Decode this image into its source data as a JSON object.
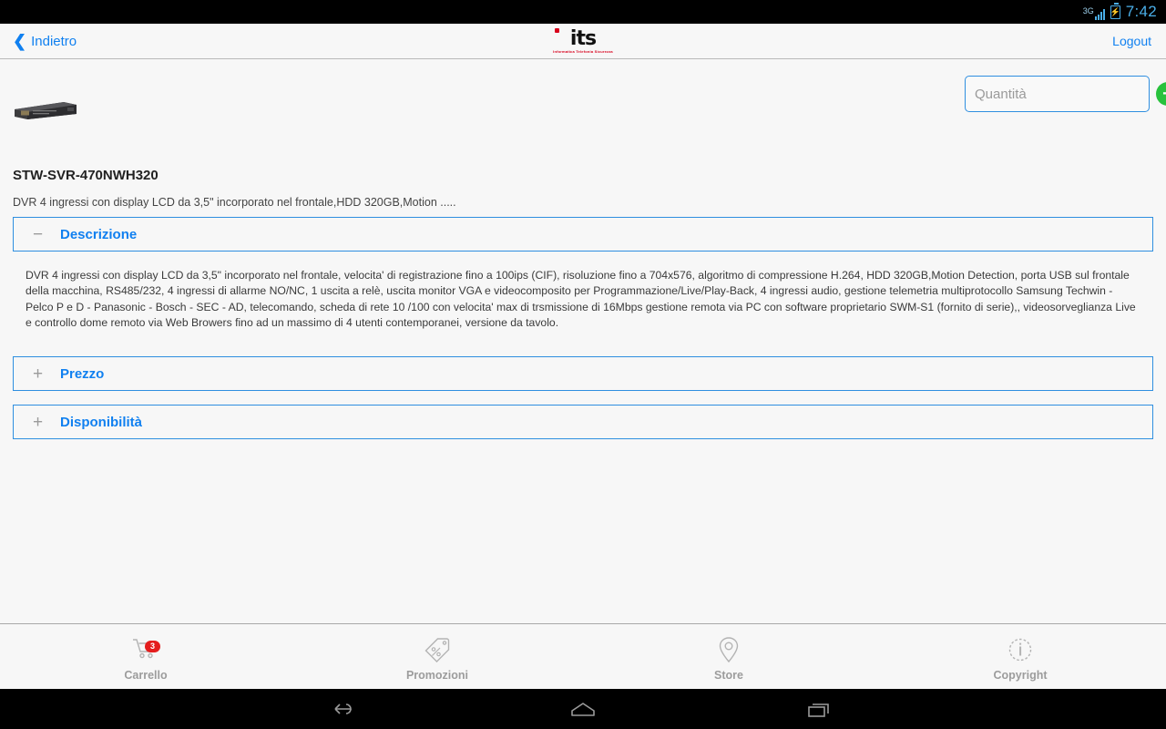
{
  "statusbar": {
    "network_label": "3G",
    "clock": "7:42",
    "battery_icon": "battery-charging-icon",
    "signal_icon": "signal-bars-icon"
  },
  "header": {
    "back_label": "Indietro",
    "logo_mark": "its",
    "logo_tagline": "Informatica Telefonia Sicurezza",
    "logout_label": "Logout"
  },
  "quantity": {
    "placeholder": "Quantità",
    "value": "",
    "add_label": "+"
  },
  "product": {
    "code": "STW-SVR-470NWH320",
    "short_description": "DVR 4 ingressi con display LCD da 3,5\" incorporato nel frontale,HDD 320GB,Motion .....",
    "image_alt": "dvr-device-image"
  },
  "sections": [
    {
      "id": "descrizione",
      "label": "Descrizione",
      "expanded": true,
      "sign": "−",
      "body": "DVR 4 ingressi con display LCD da 3,5\" incorporato nel frontale, velocita' di registrazione fino a 100ips (CIF), risoluzione fino a 704x576, algoritmo di compressione H.264, HDD 320GB,Motion Detection, porta USB sul frontale della macchina, RS485/232, 4 ingressi di allarme NO/NC, 1 uscita a relè, uscita monitor VGA e videocomposito per Programmazione/Live/Play-Back, 4 ingressi audio, gestione telemetria multiprotocollo Samsung Techwin - Pelco P e D - Panasonic - Bosch - SEC - AD, telecomando, scheda di rete 10 /100 con velocita' max di trsmissione di 16Mbps gestione remota via PC con software proprietario SWM-S1 (fornito di serie),, videosorveglianza Live e controllo dome remoto via Web Browers fino ad un massimo di 4 utenti contemporanei, versione da tavolo."
    },
    {
      "id": "prezzo",
      "label": "Prezzo",
      "expanded": false,
      "sign": "+",
      "body": ""
    },
    {
      "id": "disponibilita",
      "label": "Disponibilità",
      "expanded": false,
      "sign": "+",
      "body": ""
    }
  ],
  "bottomnav": [
    {
      "label": "Carrello",
      "icon": "shopping-cart-icon",
      "badge": "3"
    },
    {
      "label": "Promozioni",
      "icon": "price-tag-icon",
      "badge": ""
    },
    {
      "label": "Store",
      "icon": "map-pin-icon",
      "badge": ""
    },
    {
      "label": "Copyright",
      "icon": "info-circle-icon",
      "badge": ""
    }
  ],
  "androidnav": {
    "back": "back-icon",
    "home": "home-icon",
    "recents": "recents-icon"
  },
  "colors": {
    "accent_blue": "#1080f0",
    "border_blue": "#2f8fe0",
    "green_add": "#28c23c",
    "badge_red": "#e41d1d",
    "logo_red": "#d8001c",
    "page_bg": "#f7f7f7"
  }
}
